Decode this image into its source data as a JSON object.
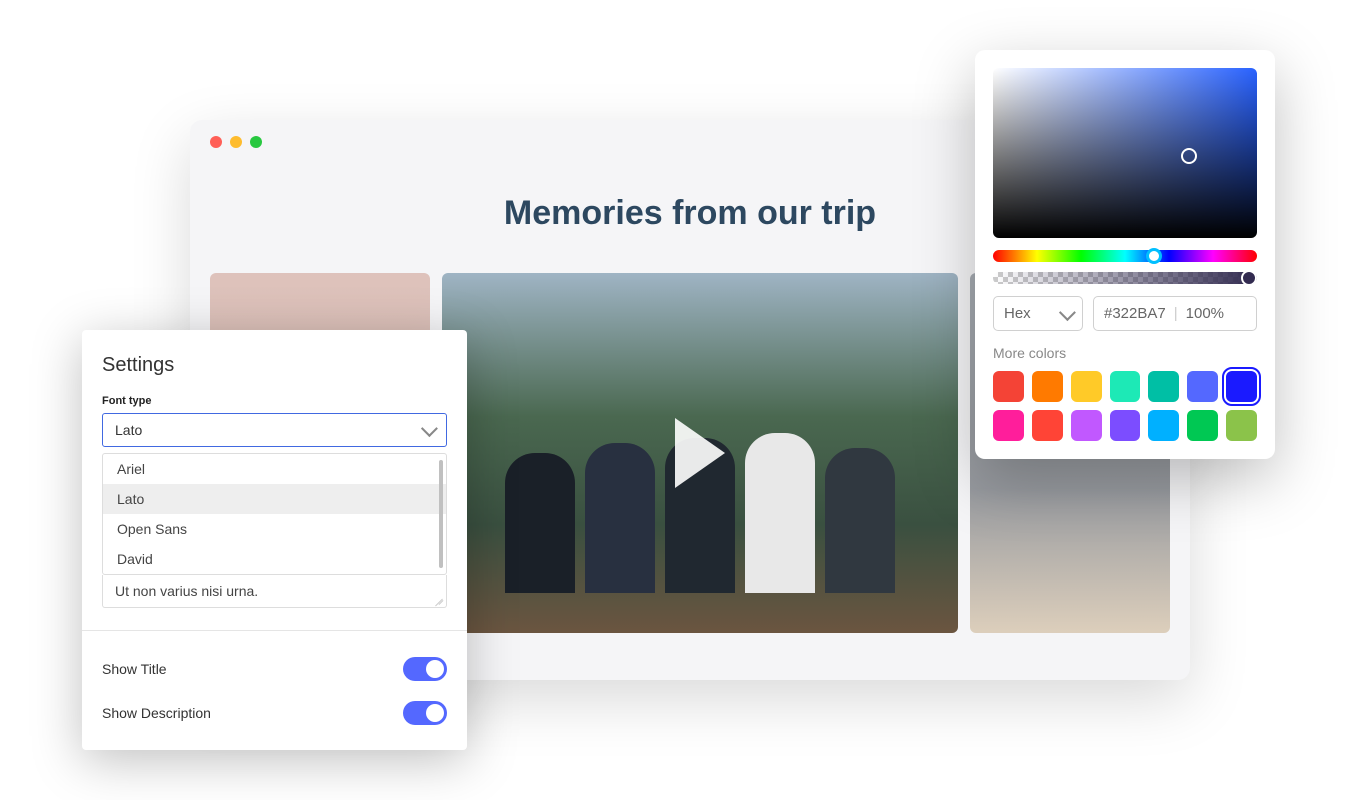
{
  "browser": {
    "page_title": "Memories from our trip"
  },
  "settings": {
    "title": "Settings",
    "font_type_label": "Font type",
    "font_type_value": "Lato",
    "font_options": [
      "Ariel",
      "Lato",
      "Open Sans",
      "David"
    ],
    "textarea_value": "Ut non varius nisi urna.",
    "toggles": [
      {
        "label": "Show Title",
        "on": true
      },
      {
        "label": "Show Description",
        "on": true
      }
    ]
  },
  "color_picker": {
    "format": "Hex",
    "hex_value": "#322BA7",
    "opacity": "100%",
    "more_colors_label": "More colors",
    "swatches_row1": [
      "#f44336",
      "#ff7a00",
      "#ffca28",
      "#1de9b6",
      "#00bfa5",
      "#5468ff",
      "#1a1aff"
    ],
    "swatches_row2": [
      "#ff1e9b",
      "#ff4436",
      "#c158ff",
      "#7c4dff",
      "#00b0ff",
      "#00c853",
      "#8bc34a"
    ],
    "selected_swatch_index": 6
  }
}
